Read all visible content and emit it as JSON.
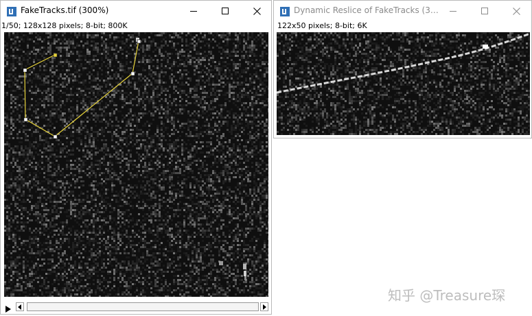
{
  "main_window": {
    "title": "FakeTracks.tif (300%)",
    "info": "1/50; 128x128 pixels; 8-bit; 800K",
    "roi_color": "#e6d23a"
  },
  "reslice_window": {
    "title": "Dynamic Reslice of FakeTracks (3…",
    "info": "122x50 pixels; 8-bit; 6K"
  },
  "icons": {
    "app": "imagej-icon",
    "minimize": "minimize-icon",
    "maximize": "maximize-icon",
    "close": "close-icon",
    "play": "play-icon",
    "scroll_left": "chevron-left-icon",
    "scroll_right": "chevron-right-icon"
  },
  "watermark": "知乎 @Treasure琛"
}
